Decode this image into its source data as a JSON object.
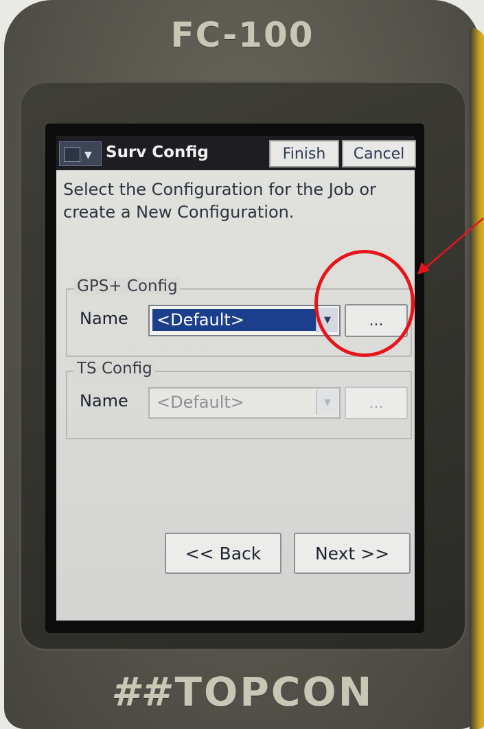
{
  "device": {
    "model": "FC-100",
    "brand": "TOPCON",
    "brand_logo": "##"
  },
  "titlebar": {
    "menu_icon": "menu-dropdown-icon",
    "title": "Surv Config",
    "finish_label": "Finish",
    "cancel_label": "Cancel"
  },
  "instructions": "Select the Configuration for the Job or create a New Configuration.",
  "gps_group": {
    "label": "GPS+ Config",
    "name_label": "Name",
    "value": "<Default>",
    "dots_label": "..."
  },
  "ts_group": {
    "label": "TS Config",
    "name_label": "Name",
    "value": "<Default>",
    "dots_label": "..."
  },
  "nav": {
    "back_label": "<< Back",
    "next_label": "Next >>"
  },
  "annotation": {
    "color": "#e8141b"
  },
  "colors": {
    "title_bar": "#1e1e22",
    "selection": "#1b3f8c",
    "screen_bg": "#dcdcd8"
  }
}
